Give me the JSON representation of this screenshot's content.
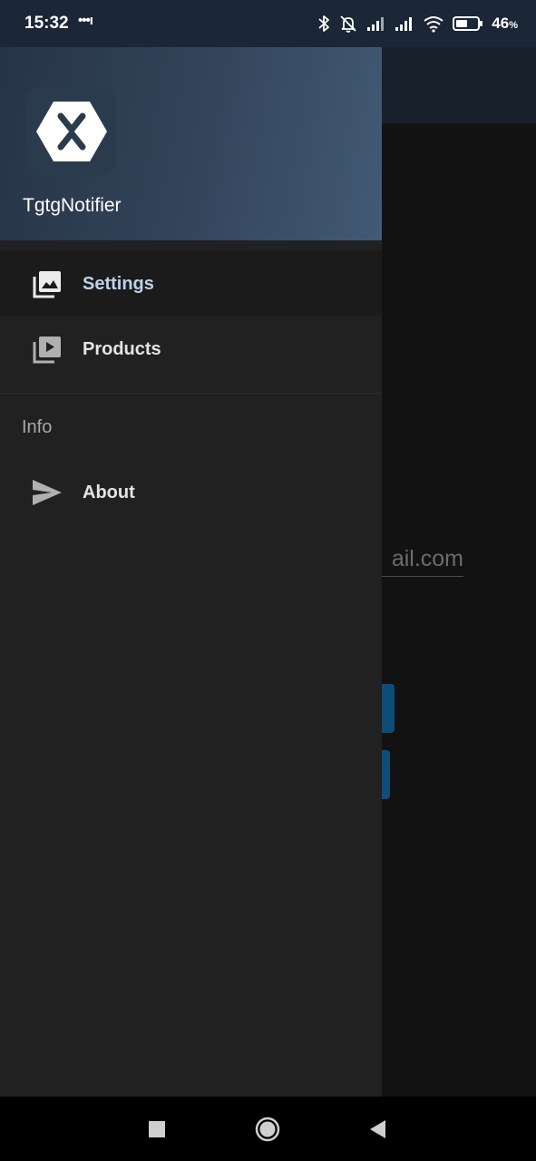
{
  "status_bar": {
    "time": "15:32",
    "notification_dots": "•••ı",
    "battery_percent": "46",
    "battery_unit": "%",
    "icons": [
      "bluetooth-icon",
      "alarm-off-icon",
      "signal-icon",
      "signal-icon",
      "wifi-icon",
      "battery-icon"
    ]
  },
  "app": {
    "email_fragment": "ail.com"
  },
  "drawer": {
    "app_name": "TgtgNotifier",
    "logo_icon": "xamarin-logo-icon",
    "items": [
      {
        "label": "Settings",
        "icon": "photo-library-icon",
        "selected": true
      },
      {
        "label": "Products",
        "icon": "video-library-icon",
        "selected": false
      }
    ],
    "section": {
      "title": "Info",
      "items": [
        {
          "label": "About",
          "icon": "send-icon"
        }
      ]
    }
  },
  "nav_bar": {
    "buttons": [
      "recents-button",
      "home-button",
      "back-button"
    ]
  },
  "colors": {
    "header_gradient_start": "#263447",
    "header_gradient_end": "#425a74",
    "drawer_bg": "#212121",
    "selected_label": "#bcd2ea",
    "accent_button": "#0f4d79"
  }
}
